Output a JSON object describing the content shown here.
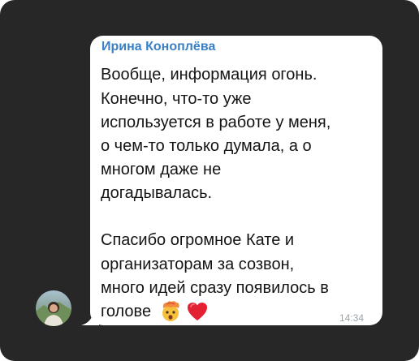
{
  "message": {
    "sender": "Ирина Коноплёва",
    "lines": [
      "Вообще, информация огонь.",
      "Конечно, что-то уже",
      "используется в работе у меня,",
      "о чем-то только думала, а о",
      "многом даже не",
      "догадывалась.",
      "",
      "Спасибо огромное Кате и",
      "организаторам за созвон,",
      "много идей сразу появилось в",
      "голове"
    ],
    "time": "14:34",
    "emojis": [
      "exploding-head-emoji",
      "red-heart-emoji"
    ]
  },
  "colors": {
    "background": "#272727",
    "bubble": "#ffffff",
    "sender_name": "#3b80c7",
    "text": "#141414",
    "time": "#9aa3a9"
  }
}
